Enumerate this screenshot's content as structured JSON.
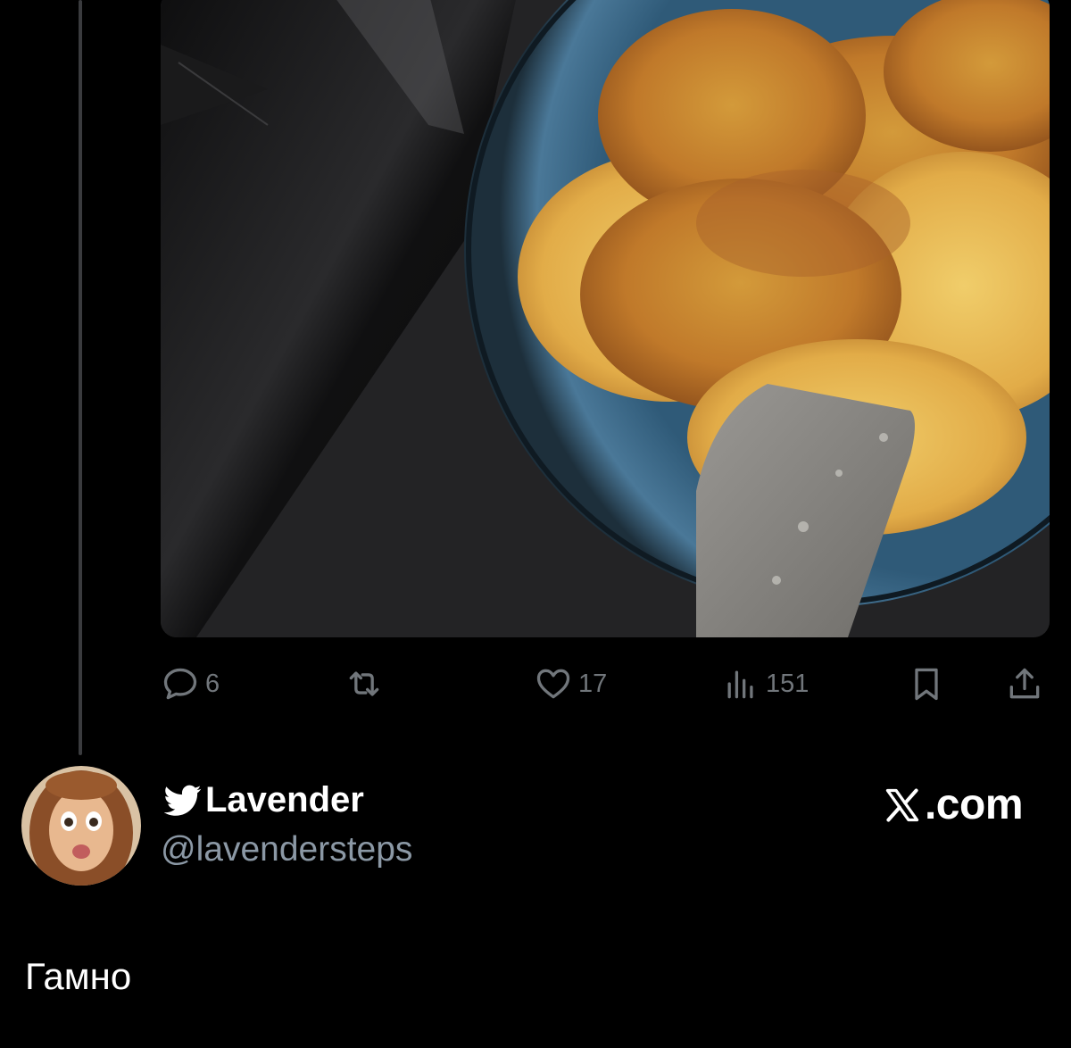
{
  "post": {
    "stats": {
      "replies": "6",
      "reposts": "",
      "likes": "17",
      "views": "151"
    }
  },
  "reply": {
    "display_name": "Lavender",
    "handle": "@lavendersteps",
    "site": ".com",
    "text": "Гамно"
  },
  "colors": {
    "background": "#000000",
    "muted": "#71767b",
    "handle": "#8b98a5",
    "thread_line": "#3a3b3e"
  },
  "icons": [
    "reply-icon",
    "repost-icon",
    "like-icon",
    "views-icon",
    "bookmark-icon",
    "share-icon",
    "bird-icon",
    "x-logo-icon"
  ]
}
